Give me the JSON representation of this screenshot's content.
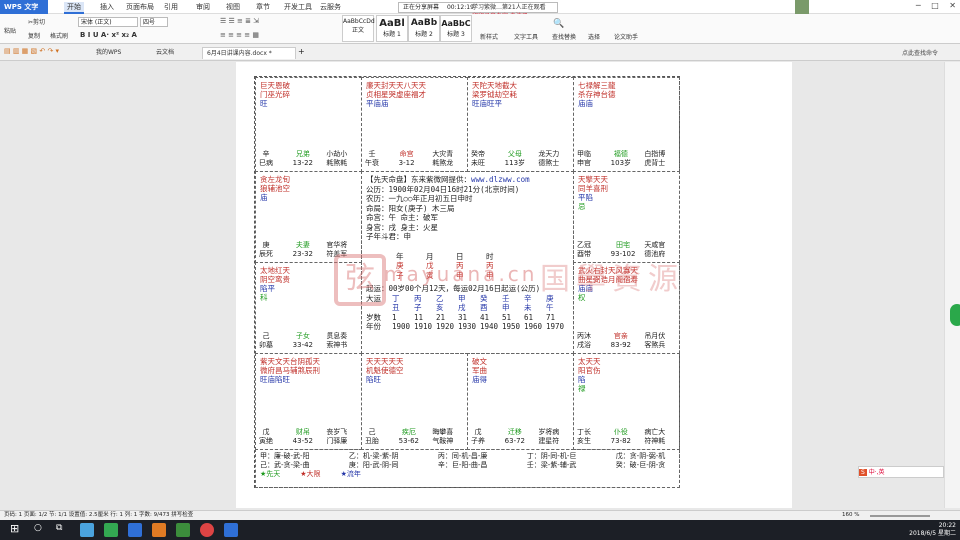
{
  "app": {
    "name": "WPS 文字",
    "title": "6月4日讲课内容.docx"
  },
  "menus": [
    "开始",
    "插入",
    "页面布局",
    "引用",
    "审阅",
    "视图",
    "章节",
    "开发工具",
    "云服务"
  ],
  "share": {
    "label": "正在分享屏幕",
    "time": "00:12:19"
  },
  "live": {
    "line1": "学习紫微…第21人正在观看",
    "line2": "留留录音专家 未注册"
  },
  "ribbon": {
    "paste": "粘贴",
    "cut": "剪切",
    "copy": "复制",
    "format_painter": "格式刷",
    "font": "宋体 (正文)",
    "size": "四号",
    "styles": [
      "正文",
      "标题 1",
      "标题 2",
      "标题 3"
    ],
    "style_previews": [
      "AaBbCcDd",
      "AaBl",
      "AaBb",
      "AaBbC"
    ],
    "new_style": "新样式",
    "text_tools": "文字工具",
    "find": "查找替换",
    "select": "选择",
    "assistant": "论文助手",
    "search_cmd": "点此查找命令"
  },
  "tabs": [
    "我的WPS",
    "云文档",
    "6月4日讲课内容.docx *"
  ],
  "chart": {
    "cells": [
      {
        "id": "si",
        "main": [
          [
            "巨天恩破",
            "red"
          ],
          [
            "门巫光碎",
            "red"
          ],
          [
            "旺",
            "blue"
          ]
        ],
        "b_left": [
          "辛",
          "巳病"
        ],
        "b_mid": [
          "兄弟",
          "13-22"
        ],
        "b_right": [
          "小劫小",
          "耗煞耗"
        ]
      },
      {
        "id": "wu",
        "main": [
          [
            "廉天封天天八天天",
            "red"
          ],
          [
            "贞相星哭虚座福才",
            "red"
          ],
          [
            "平庙庙",
            "blue"
          ]
        ],
        "b_left": [
          "壬",
          "午衰"
        ],
        "b_mid": [
          "命宫",
          "3-12"
        ],
        "b_right": [
          "大灾青",
          "耗煞龙"
        ]
      },
      {
        "id": "wei",
        "main": [
          [
            "天陀天地截大",
            "red"
          ],
          [
            "梁罗钺劫空耗",
            "red"
          ],
          [
            "旺庙旺平",
            "blue"
          ]
        ],
        "b_left": [
          "癸帝",
          "未旺"
        ],
        "b_mid": [
          "父母",
          "113岁"
        ],
        "b_right": [
          "龙天力",
          "德煞士"
        ]
      },
      {
        "id": "shen",
        "main": [
          [
            "七禄解三龍",
            "red"
          ],
          [
            "杀存神台德",
            "red"
          ],
          [
            "庙庙",
            "blue"
          ]
        ],
        "b_left": [
          "甲临",
          "申官"
        ],
        "b_mid": [
          "福德",
          "103岁"
        ],
        "b_right": [
          "白指博",
          "虎背士"
        ]
      },
      {
        "id": "chen",
        "main": [
          [
            "贪左龙旬",
            "red"
          ],
          [
            "狼辅池空",
            "red"
          ],
          [
            "庙",
            "blue"
          ]
        ],
        "b_left": [
          "庚",
          "辰死"
        ],
        "b_mid": [
          "夫妻",
          "23-32"
        ],
        "b_right": [
          "官华将",
          "符盖军"
        ]
      },
      {
        "id": "you",
        "main": [
          [
            "天擎天天",
            "red"
          ],
          [
            "同羊喜刑",
            "red"
          ],
          [
            "平陷",
            "blue"
          ],
          [
            "忌",
            "green"
          ]
        ],
        "b_left": [
          "乙冠",
          "酉带"
        ],
        "b_mid": [
          "田宅",
          "93-102"
        ],
        "b_right": [
          "天咸官",
          "德池府"
        ]
      },
      {
        "id": "mao",
        "main": [
          [
            "太地红天",
            "red"
          ],
          [
            "阴空鸾贵",
            "red"
          ],
          [
            "陷平",
            "blue"
          ],
          [
            "科",
            "green"
          ]
        ],
        "b_left": [
          "己",
          "卯墓"
        ],
        "b_mid": [
          "子女",
          "33-42"
        ],
        "b_right": [
          "贯息奏",
          "索神书"
        ]
      },
      {
        "id": "xu",
        "main": [
          [
            "武火右封天风寡天",
            "red"
          ],
          [
            "曲星弼诰月阁宿寿",
            "red"
          ],
          [
            "庙庙",
            "blue"
          ],
          [
            "权",
            "green"
          ]
        ],
        "b_left": [
          "丙沐",
          "戌浴"
        ],
        "b_mid": [
          "官亲",
          "83-92"
        ],
        "b_right": [
          "吊月伏",
          "客煞兵"
        ]
      },
      {
        "id": "yin",
        "main": [
          [
            "紫天文天台阴孤天",
            "red"
          ],
          [
            "微府昌马辅煞辰刑",
            "red"
          ],
          [
            "旺庙陷旺",
            "blue"
          ]
        ],
        "b_left": [
          "戊",
          "寅绝"
        ],
        "b_mid": [
          "财帛",
          "43-52"
        ],
        "b_right": [
          "丧岁飞",
          "门驿廉"
        ]
      },
      {
        "id": "chou",
        "main": [
          [
            "天天天天天",
            "red"
          ],
          [
            "机魁使德空",
            "red"
          ],
          [
            "陷旺",
            "blue"
          ]
        ],
        "b_left": [
          "己",
          "丑胎"
        ],
        "b_mid": [
          "疾厄",
          "53-62"
        ],
        "b_right": [
          "晦攀喜",
          "气鞍神"
        ]
      },
      {
        "id": "zi",
        "main": [
          [
            "破文",
            "red"
          ],
          [
            "军曲",
            "red"
          ],
          [
            "庙得",
            "blue"
          ]
        ],
        "b_left": [
          "戊",
          "子养"
        ],
        "b_mid": [
          "迁移",
          "63-72"
        ],
        "b_right": [
          "岁将病",
          "建星符"
        ]
      },
      {
        "id": "hai",
        "main": [
          [
            "太天天",
            "red"
          ],
          [
            "阳官伤",
            "red"
          ],
          [
            "陷",
            "blue"
          ],
          [
            "禄",
            "green"
          ]
        ],
        "b_left": [
          "丁长",
          "亥生"
        ],
        "b_mid": [
          "仆役",
          "73-82"
        ],
        "b_right": [
          "病亡大",
          "符神耗"
        ]
      }
    ],
    "center": {
      "header": "【先天命盘】东来紫微网提供：",
      "url": "www.dlzww.com",
      "lines": [
        "公历：1900年02月04日16时21分(北京时间)",
        "农历：一九○○年正月初五日申时",
        "命局：阳女(庚子)  木三局",
        "命宫：午     命主：破军",
        "身宫：戌     身主：火星",
        "子年斗君：申"
      ],
      "pillars_labels": [
        "年",
        "月",
        "日",
        "时"
      ],
      "pillars_top": [
        "庚",
        "戊",
        "丙",
        "丙"
      ],
      "pillars_bot": [
        "子",
        "寅",
        "申",
        "申"
      ],
      "qiyun": "起运：00岁00个月12天，每运02月16日起运(公历)",
      "dayun_label": "大运",
      "dayun_top": [
        "丁",
        "丙",
        "乙",
        "甲",
        "癸",
        "壬",
        "辛",
        "庚"
      ],
      "dayun_bot": [
        "丑",
        "子",
        "亥",
        "戌",
        "酉",
        "申",
        "未",
        "午"
      ],
      "age_label": "岁数",
      "ages": [
        "1",
        "11",
        "21",
        "31",
        "41",
        "51",
        "61",
        "71"
      ],
      "year_label": "年份",
      "years": [
        "1900",
        "1910",
        "1920",
        "1930",
        "1940",
        "1950",
        "1960",
        "1970"
      ]
    },
    "sihua": [
      [
        "甲：廉-破-武-阳",
        "乙：机-梁-紫-阴",
        "丙：同-机-昌-廉",
        "丁：阴-同-机-巨",
        "戊：贪-阴-弼-机"
      ],
      [
        "己：武-贪-梁-曲",
        "庚：阳-武-阴-同",
        "辛：巨-阳-曲-昌",
        "壬：梁-紫-辅-武",
        "癸：破-巨-阴-贪"
      ]
    ],
    "legend": [
      "★先天",
      "★大限",
      "★流年"
    ]
  },
  "watermark": {
    "text": "国學資源",
    "url": "mayuana.cn"
  },
  "status": {
    "text": "页码: 1  页面: 1/2  节: 1/1  设置值: 2.5厘米  行: 1  列: 1  字数: 9/473  拼写检查",
    "zoom": "160 %"
  },
  "ime": "中·,英",
  "clock": {
    "time": "20:22",
    "date": "2018/6/5 星期二"
  },
  "colors": {
    "accent": "#2f6fd6",
    "red": "#c0302a",
    "blue": "#2436a8",
    "green": "#1d9a1d"
  }
}
